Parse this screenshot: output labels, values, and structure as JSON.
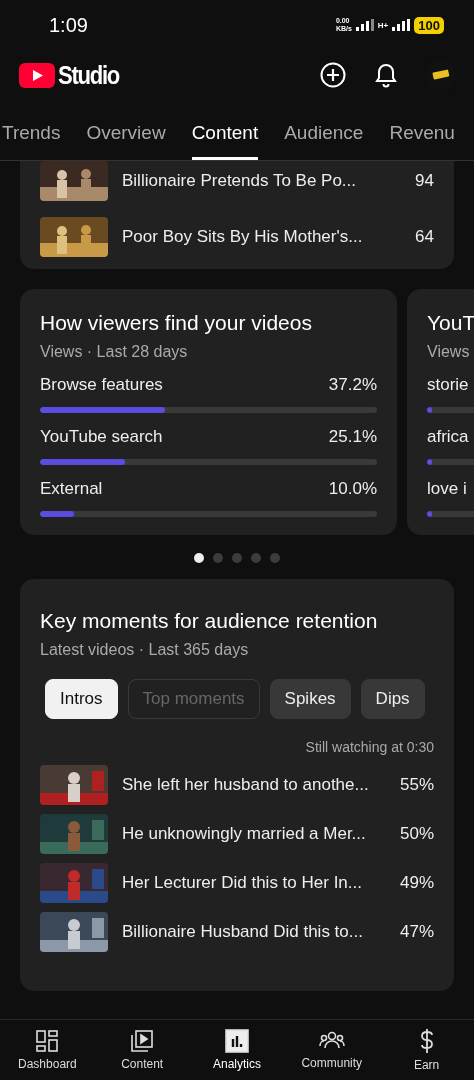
{
  "status_bar": {
    "time": "1:09",
    "speed": "0.00",
    "speed_unit": "KB/s",
    "network": "H+",
    "battery": "100"
  },
  "header": {
    "title": "Studio"
  },
  "tabs": [
    {
      "label": "Trends",
      "selected": false
    },
    {
      "label": "Overview",
      "selected": false
    },
    {
      "label": "Content",
      "selected": true
    },
    {
      "label": "Audience",
      "selected": false
    },
    {
      "label": "Revenu",
      "selected": false
    }
  ],
  "top_videos": [
    {
      "title": "Billionaire Pretends To Be Po...",
      "views": "94"
    },
    {
      "title": "Poor Boy Sits By His Mother's...",
      "views": "64"
    }
  ],
  "cards": [
    {
      "title": "How viewers find your videos",
      "subtitle": "Views · Last 28 days",
      "rows": [
        {
          "label": "Browse features",
          "value": "37.2%",
          "level": 0.372
        },
        {
          "label": "YouTube search",
          "value": "25.1%",
          "level": 0.251
        },
        {
          "label": "External",
          "value": "10.0%",
          "level": 0.1
        }
      ]
    },
    {
      "title": "YouT",
      "subtitle": "Views",
      "rows": [
        {
          "label": "storie",
          "level": 0.03
        },
        {
          "label": "africa",
          "level": 0.02
        },
        {
          "label": "love i",
          "level": 0.02
        }
      ]
    }
  ],
  "pager": [
    {
      "selected": true
    },
    {
      "selected": false
    },
    {
      "selected": false
    },
    {
      "selected": false
    },
    {
      "selected": false
    }
  ],
  "retention": {
    "title": "Key moments for audience retention",
    "subtitle": "Latest videos · Last 365 days",
    "chips": [
      {
        "label": "Intros",
        "selected": true,
        "disabled": false
      },
      {
        "label": "Top moments",
        "selected": false,
        "disabled": true
      },
      {
        "label": "Spikes",
        "selected": false,
        "disabled": false
      },
      {
        "label": "Dips",
        "selected": false,
        "disabled": false
      }
    ],
    "caption": "Still watching at 0:30",
    "videos": [
      {
        "title": "She left her husband to anothe...",
        "value": "55%"
      },
      {
        "title": "He unknowingly married a Mer...",
        "value": "50%"
      },
      {
        "title": "Her Lecturer Did this to Her In...",
        "value": "49%"
      },
      {
        "title": "Billionaire Husband Did this to...",
        "value": "47%"
      }
    ]
  },
  "bottom_nav": [
    {
      "label": "Dashboard",
      "kind": "dashboard",
      "selected": false
    },
    {
      "label": "Content",
      "kind": "content",
      "selected": false
    },
    {
      "label": "Analytics",
      "kind": "analytics",
      "selected": true
    },
    {
      "label": "Community",
      "kind": "community",
      "selected": false
    },
    {
      "label": "Earn",
      "kind": "earn",
      "selected": false
    }
  ]
}
